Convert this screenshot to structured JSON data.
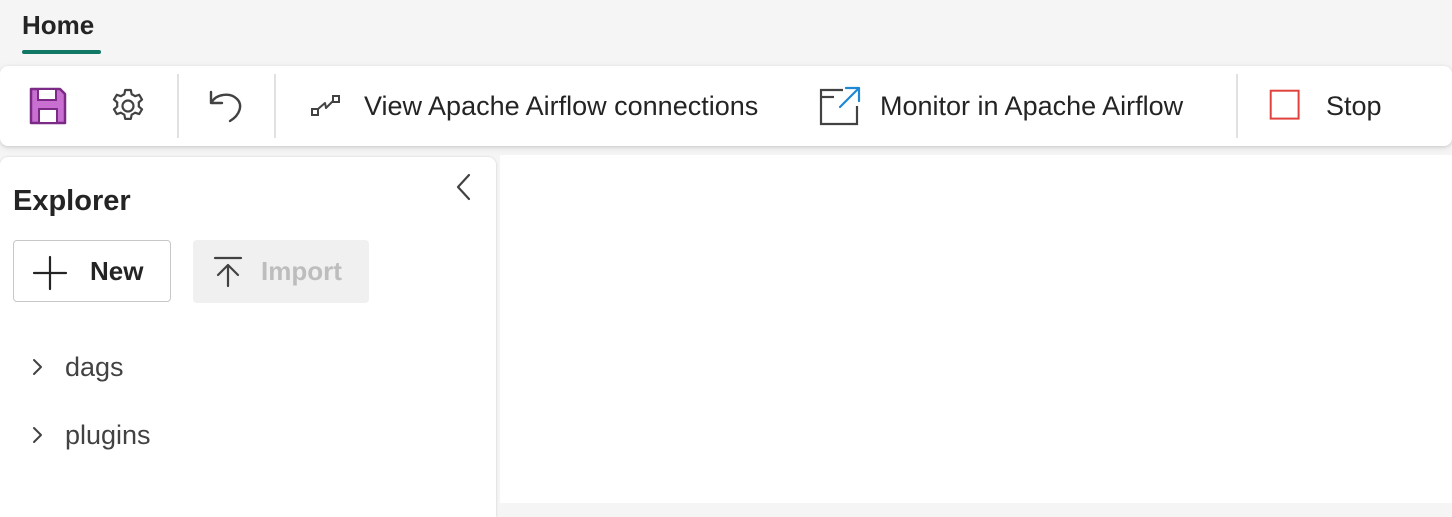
{
  "tabs": [
    {
      "label": "Home",
      "active": true
    }
  ],
  "toolbar": {
    "save_icon": "save-icon",
    "settings_icon": "gear-icon",
    "undo_icon": "undo-icon",
    "view_connections_label": "View Apache Airflow connections",
    "monitor_label": "Monitor in Apache Airflow",
    "stop_label": "Stop"
  },
  "explorer": {
    "title": "Explorer",
    "new_label": "New",
    "import_label": "Import",
    "items": [
      {
        "label": "dags"
      },
      {
        "label": "plugins"
      }
    ]
  },
  "colors": {
    "accent": "#117865",
    "save_icon_fill": "#c86fd1",
    "stop_icon": "#e0413c",
    "monitor_arrow": "#1e88d4"
  }
}
